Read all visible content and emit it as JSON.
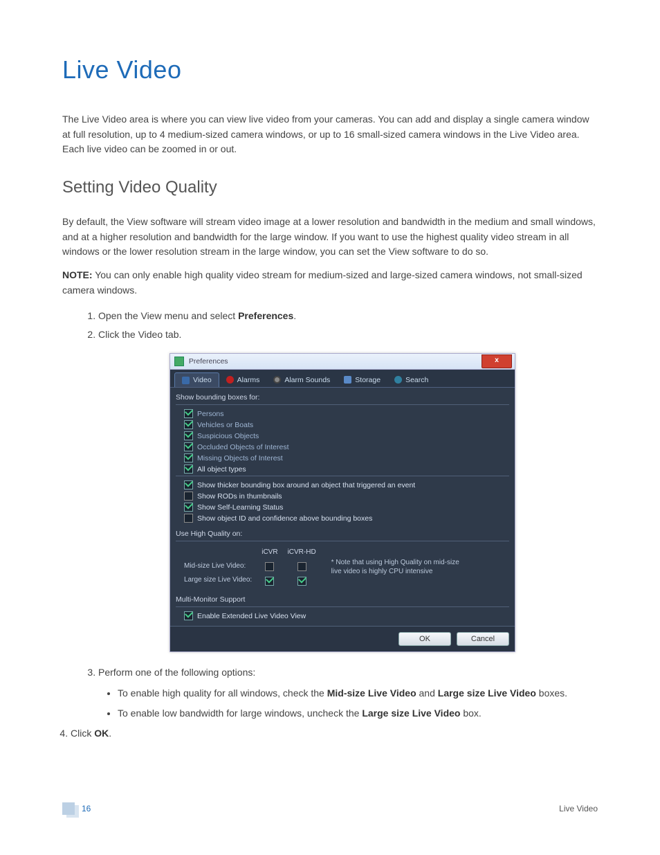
{
  "doc": {
    "h1": "Live Video",
    "intro": "The Live Video area is where you can view live video from your cameras. You can add and display a single camera window at full resolution, up to 4 medium-sized camera windows, or up to 16 small-sized camera windows in the Live Video area. Each live video can be zoomed in or out.",
    "h2": "Setting Video Quality",
    "p2": "By default, the View software will stream video image at a lower resolution and bandwidth in the medium and small windows, and at a higher resolution and bandwidth for the large window. If you want to use the highest quality video stream in all windows or the lower resolution stream in the large window, you can set the View software to do so.",
    "note_prefix": "NOTE:",
    "note_body": " You can only enable high quality video stream for medium-sized and large-sized camera windows, not small-sized camera windows.",
    "step1_a": "Open the View menu and select ",
    "step1_b": "Preferences",
    "step1_c": ".",
    "step2": "Click the Video tab.",
    "step3": "Perform one of the following options:",
    "step3a_a": "To enable high quality for all windows, check the ",
    "step3a_b": "Mid-size Live Video",
    "step3a_c": " and ",
    "step3a_d": "Large size Live Video",
    "step3a_e": " boxes.",
    "step3b_a": "To enable low bandwidth for large windows, uncheck the ",
    "step3b_b": "Large size Live Video",
    "step3b_c": " box.",
    "step4_a": "Click ",
    "step4_b": "OK",
    "step4_c": "."
  },
  "dialog": {
    "title": "Preferences",
    "close": "x",
    "tabs": {
      "video": "Video",
      "alarms": "Alarms",
      "alarm_sounds": "Alarm Sounds",
      "storage": "Storage",
      "search": "Search"
    },
    "show_bb_label": "Show bounding boxes for:",
    "checks": {
      "persons": "Persons",
      "vehicles": "Vehicles or Boats",
      "suspicious": "Suspicious Objects",
      "occluded": "Occluded Objects of Interest",
      "missing": "Missing Objects of Interest",
      "alltypes": "All object types",
      "thicker": "Show thicker bounding box around an object that triggered an event",
      "rods": "Show RODs in thumbnails",
      "selflearn": "Show Self-Learning Status",
      "objid": "Show object ID and confidence above bounding boxes"
    },
    "hq": {
      "label": "Use High Quality on:",
      "col1": "iCVR",
      "col2": "iCVR-HD",
      "row1": "Mid-size Live Video:",
      "row2": "Large size Live Video:",
      "note": "* Note that using High Quality on mid-size live video is highly CPU intensive"
    },
    "mm_label": "Multi-Monitor Support",
    "mm_check": "Enable Extended Live Video View",
    "ok": "OK",
    "cancel": "Cancel"
  },
  "footer": {
    "page": "16",
    "section": "Live Video"
  }
}
